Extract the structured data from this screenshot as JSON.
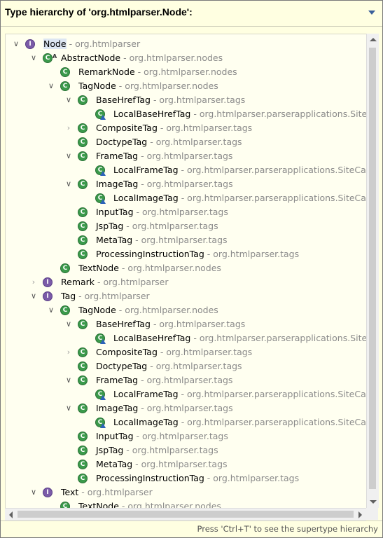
{
  "popup": {
    "title": "Type hierarchy of 'org.htmlparser.Node':",
    "status_hint": "Press 'Ctrl+T' to see the supertype hierarchy"
  },
  "icons": {
    "class": "class-icon",
    "interface": "interface-icon",
    "abstract_marker": "A"
  },
  "colors": {
    "popup_bg": "#ffffe1",
    "class_icon": "#3b9a4b",
    "interface_icon": "#7b5ba8",
    "package_text": "#8a8a8a",
    "selection": "#dde6f2"
  },
  "tree": [
    {
      "name": "Node",
      "pkg": " - org.htmlparser",
      "level": 0,
      "toggle": "expanded",
      "icon": "interface",
      "selected": true
    },
    {
      "name": "AbstractNode",
      "pkg": " - org.htmlparser.nodes",
      "level": 1,
      "toggle": "expanded",
      "icon": "class",
      "abstract": true
    },
    {
      "name": "RemarkNode",
      "pkg": " - org.htmlparser.nodes",
      "level": 2,
      "toggle": "none",
      "icon": "class"
    },
    {
      "name": "TagNode",
      "pkg": " - org.htmlparser.nodes",
      "level": 2,
      "toggle": "expanded",
      "icon": "class"
    },
    {
      "name": "BaseHrefTag",
      "pkg": " - org.htmlparser.tags",
      "level": 3,
      "toggle": "expanded",
      "icon": "class"
    },
    {
      "name": "LocalBaseHrefTag",
      "pkg": " - org.htmlparser.parserapplications.SiteCap",
      "level": 4,
      "toggle": "none",
      "icon": "class",
      "overlay": true
    },
    {
      "name": "CompositeTag",
      "pkg": " - org.htmlparser.tags",
      "level": 3,
      "toggle": "collapsed",
      "icon": "class"
    },
    {
      "name": "DoctypeTag",
      "pkg": " - org.htmlparser.tags",
      "level": 3,
      "toggle": "none",
      "icon": "class"
    },
    {
      "name": "FrameTag",
      "pkg": " - org.htmlparser.tags",
      "level": 3,
      "toggle": "expanded",
      "icon": "class"
    },
    {
      "name": "LocalFrameTag",
      "pkg": " - org.htmlparser.parserapplications.SiteCaptur",
      "level": 4,
      "toggle": "none",
      "icon": "class",
      "overlay": true
    },
    {
      "name": "ImageTag",
      "pkg": " - org.htmlparser.tags",
      "level": 3,
      "toggle": "expanded",
      "icon": "class"
    },
    {
      "name": "LocalImageTag",
      "pkg": " - org.htmlparser.parserapplications.SiteCaptur",
      "level": 4,
      "toggle": "none",
      "icon": "class",
      "overlay": true
    },
    {
      "name": "InputTag",
      "pkg": " - org.htmlparser.tags",
      "level": 3,
      "toggle": "none",
      "icon": "class"
    },
    {
      "name": "JspTag",
      "pkg": " - org.htmlparser.tags",
      "level": 3,
      "toggle": "none",
      "icon": "class"
    },
    {
      "name": "MetaTag",
      "pkg": " - org.htmlparser.tags",
      "level": 3,
      "toggle": "none",
      "icon": "class"
    },
    {
      "name": "ProcessingInstructionTag",
      "pkg": " - org.htmlparser.tags",
      "level": 3,
      "toggle": "none",
      "icon": "class"
    },
    {
      "name": "TextNode",
      "pkg": " - org.htmlparser.nodes",
      "level": 2,
      "toggle": "none",
      "icon": "class"
    },
    {
      "name": "Remark",
      "pkg": " - org.htmlparser",
      "level": 1,
      "toggle": "collapsed",
      "icon": "interface"
    },
    {
      "name": "Tag",
      "pkg": " - org.htmlparser",
      "level": 1,
      "toggle": "expanded",
      "icon": "interface"
    },
    {
      "name": "TagNode",
      "pkg": " - org.htmlparser.nodes",
      "level": 2,
      "toggle": "expanded",
      "icon": "class"
    },
    {
      "name": "BaseHrefTag",
      "pkg": " - org.htmlparser.tags",
      "level": 3,
      "toggle": "expanded",
      "icon": "class"
    },
    {
      "name": "LocalBaseHrefTag",
      "pkg": " - org.htmlparser.parserapplications.SiteCap",
      "level": 4,
      "toggle": "none",
      "icon": "class",
      "overlay": true
    },
    {
      "name": "CompositeTag",
      "pkg": " - org.htmlparser.tags",
      "level": 3,
      "toggle": "collapsed",
      "icon": "class"
    },
    {
      "name": "DoctypeTag",
      "pkg": " - org.htmlparser.tags",
      "level": 3,
      "toggle": "none",
      "icon": "class"
    },
    {
      "name": "FrameTag",
      "pkg": " - org.htmlparser.tags",
      "level": 3,
      "toggle": "expanded",
      "icon": "class"
    },
    {
      "name": "LocalFrameTag",
      "pkg": " - org.htmlparser.parserapplications.SiteCaptur",
      "level": 4,
      "toggle": "none",
      "icon": "class",
      "overlay": true
    },
    {
      "name": "ImageTag",
      "pkg": " - org.htmlparser.tags",
      "level": 3,
      "toggle": "expanded",
      "icon": "class"
    },
    {
      "name": "LocalImageTag",
      "pkg": " - org.htmlparser.parserapplications.SiteCaptur",
      "level": 4,
      "toggle": "none",
      "icon": "class",
      "overlay": true
    },
    {
      "name": "InputTag",
      "pkg": " - org.htmlparser.tags",
      "level": 3,
      "toggle": "none",
      "icon": "class"
    },
    {
      "name": "JspTag",
      "pkg": " - org.htmlparser.tags",
      "level": 3,
      "toggle": "none",
      "icon": "class"
    },
    {
      "name": "MetaTag",
      "pkg": " - org.htmlparser.tags",
      "level": 3,
      "toggle": "none",
      "icon": "class"
    },
    {
      "name": "ProcessingInstructionTag",
      "pkg": " - org.htmlparser.tags",
      "level": 3,
      "toggle": "none",
      "icon": "class"
    },
    {
      "name": "Text",
      "pkg": " - org.htmlparser",
      "level": 1,
      "toggle": "expanded",
      "icon": "interface"
    },
    {
      "name": "TextNode",
      "pkg": " - org.htmlparser.nodes",
      "level": 2,
      "toggle": "none",
      "icon": "class"
    }
  ]
}
